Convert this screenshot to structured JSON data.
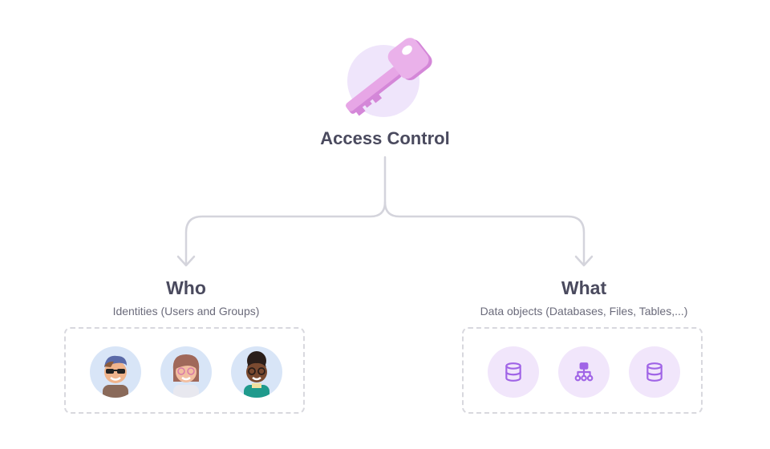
{
  "diagram": {
    "title": "Access Control",
    "center_icon": "key-icon",
    "branches": [
      {
        "title": "Who",
        "subtitle": "Identities (Users and Groups)",
        "items": [
          {
            "icon": "avatar-sunglasses-icon"
          },
          {
            "icon": "avatar-woman-icon"
          },
          {
            "icon": "avatar-glasses-icon"
          }
        ]
      },
      {
        "title": "What",
        "subtitle": "Data objects (Databases, Files, Tables,...)",
        "items": [
          {
            "icon": "database-icon"
          },
          {
            "icon": "hierarchy-icon"
          },
          {
            "icon": "database-icon"
          }
        ]
      }
    ]
  },
  "colors": {
    "text_dark": "#4a4a5e",
    "text_muted": "#6b6b7b",
    "connector": "#d4d4dc",
    "key_pink": "#e7a6e6",
    "key_backdrop": "#efe5fb",
    "object_bg": "#f1e6fb",
    "object_icon": "#a064e6",
    "avatar_bg": "#d8e5f7"
  }
}
